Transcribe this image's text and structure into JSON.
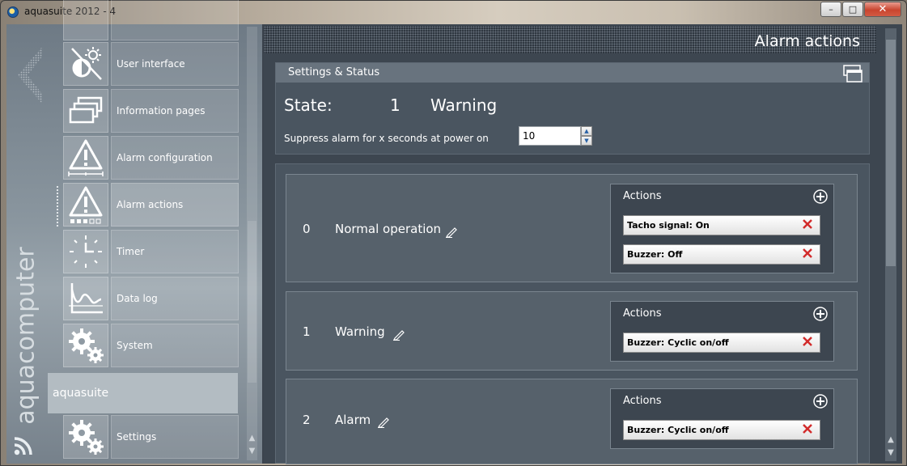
{
  "window": {
    "title": "aquasuite 2012 - 4",
    "min_glyph": "–",
    "max_glyph": "□",
    "close_glyph": "✕"
  },
  "brand": {
    "text": "aquacomputer"
  },
  "sidebar": {
    "items": [
      {
        "label": "User interface",
        "icon": "user-interface-icon"
      },
      {
        "label": "Information pages",
        "icon": "information-pages-icon"
      },
      {
        "label": "Alarm configuration",
        "icon": "alarm-configuration-icon"
      },
      {
        "label": "Alarm actions",
        "icon": "alarm-actions-icon",
        "active": true
      },
      {
        "label": "Timer",
        "icon": "timer-icon"
      },
      {
        "label": "Data log",
        "icon": "data-log-icon"
      },
      {
        "label": "System",
        "icon": "gear-icon"
      }
    ],
    "group": "aquasuite",
    "settings": {
      "label": "Settings",
      "icon": "gear-icon"
    }
  },
  "header": {
    "title": "Alarm actions"
  },
  "status": {
    "heading": "Settings & Status",
    "state_label": "State:",
    "state_number": "1",
    "state_text": "Warning",
    "suppress_label": "Suppress alarm for x seconds at power on",
    "suppress_value": "10"
  },
  "states": [
    {
      "index": "0",
      "name": "Normal operation",
      "actions_title": "Actions",
      "actions": [
        "Tacho signal: On",
        "Buzzer: Off"
      ]
    },
    {
      "index": "1",
      "name": "Warning",
      "actions_title": "Actions",
      "actions": [
        "Buzzer: Cyclic on/off"
      ]
    },
    {
      "index": "2",
      "name": "Alarm",
      "actions_title": "Actions",
      "actions": [
        "Buzzer: Cyclic on/off"
      ]
    }
  ],
  "colors": {
    "panel": "#4a5560",
    "panel_header": "#68737e",
    "delete_red": "#d22b2b",
    "close_button": "#c9452f"
  }
}
